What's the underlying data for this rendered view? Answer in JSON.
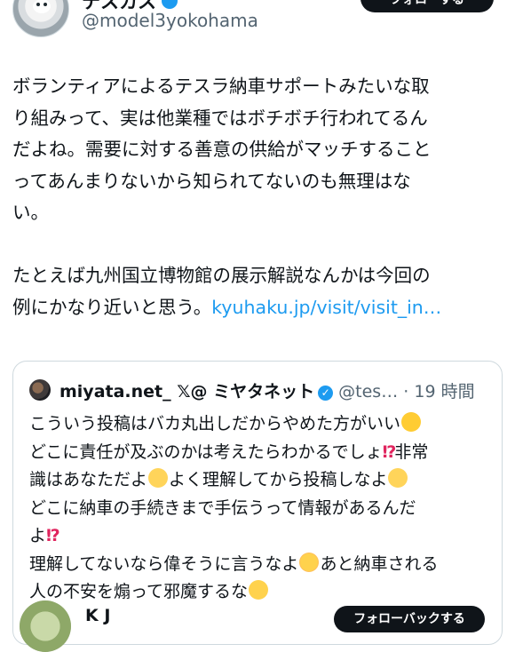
{
  "author": {
    "display_name": "テスカス",
    "handle": "@model3yokohama",
    "verified_icon": "verified-badge-icon",
    "follow_label": "フォローする"
  },
  "tweet": {
    "lines": [
      "ボランティアによるテスラ納車サポートみたいな取",
      "り組みって、実は他業種ではボチボチ行われてるん",
      "だよね。需要に対する善意の供給がマッチすること",
      "ってあんまりないから知られてないのも無理はな",
      "い。"
    ],
    "line_6_text": "たとえば九州国立博物館の展示解説なんかは今回の",
    "line_7_text": "例にかなり近いと思う。",
    "link_text": "kyuhaku.jp/visit/visit_in…",
    "link_color": "#1d9bf0"
  },
  "quote": {
    "name": "miyata.net_ 𝕏@ ミヤタネット",
    "handle": "@tes…",
    "separator": "·",
    "time": "19 時間",
    "line_1": "こういう投稿はバカ丸出しだからやめた方がいい",
    "line_2a": "どこに責任が及ぶのかは考えたらわかるでしょ",
    "line_2b": "非常",
    "line_3a": "識はあなただよ",
    "line_3b": "よく理解してから投稿しなよ",
    "line_4": "どこに納車の手続きまで手伝うって情報があるんだ",
    "line_5": "よ",
    "line_6a": "理解してないなら偉そうに言うなよ",
    "line_6b": "あと納車される",
    "line_7": "人の不安を煽って邪魔するな",
    "exclaim_glyph": "⁉",
    "emoji_names": [
      "laughing-crying-icon",
      "shushing-face-icon",
      "kissing-face-icon",
      "winking-face-icon"
    ]
  },
  "next_reply": {
    "name": "K J",
    "followback_label": "フォローバックする"
  },
  "colors": {
    "accent": "#1d9bf0",
    "text": "#0f1419",
    "secondary": "#536471",
    "border": "#cfd9de"
  }
}
